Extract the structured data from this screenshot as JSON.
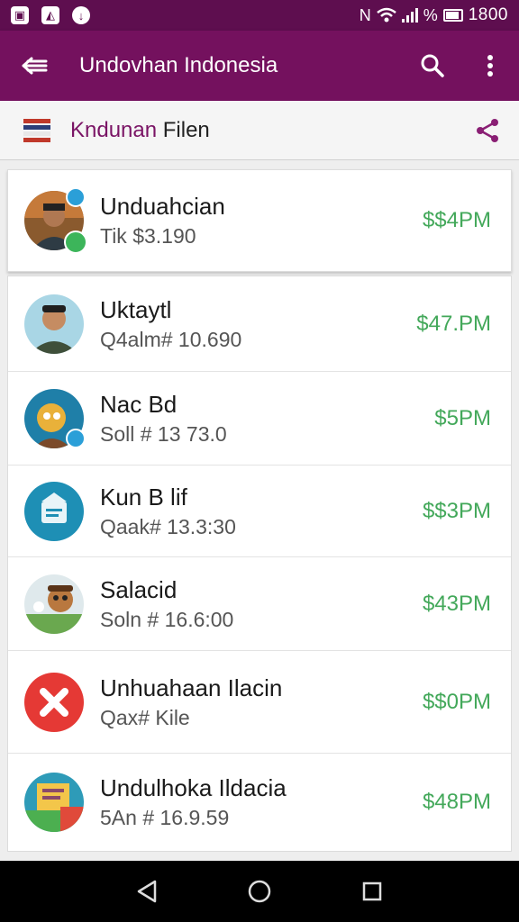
{
  "status": {
    "time": "1800",
    "percent": "%",
    "nfc": "N",
    "notif_icons": [
      "gallery-notification-icon",
      "image-notification-icon",
      "download-notification-icon"
    ]
  },
  "appbar": {
    "title": "Undovhan Indonesia"
  },
  "subbar": {
    "title_a": "Kndunan",
    "title_b": " Filen"
  },
  "featured": {
    "name": "Unduahcian",
    "sub": "Tik $3.190",
    "amount": "$$4PM"
  },
  "items": [
    {
      "name": "Uktaytl",
      "sub": "Q4alm# 10.690",
      "amount": "$47.PM"
    },
    {
      "name": "Nac Bd",
      "sub": "Soll # 13 73.0",
      "amount": "$5PM"
    },
    {
      "name": "Kun B lif",
      "sub": "Qaak# 13.3:30",
      "amount": "$$3PM"
    },
    {
      "name": "Salacid",
      "sub": "Soln # 16.6:00",
      "amount": "$43PM"
    },
    {
      "name": "Unhuahaan Ilacin",
      "sub": "Qax# Kile",
      "amount": "$$0PM"
    },
    {
      "name": "Undulhoka Ildacia",
      "sub": "5An # 16.9.59",
      "amount": "$48PM"
    }
  ],
  "colors": {
    "statusbar": "#5e0e4f",
    "appbar": "#74115e",
    "accent": "#8a1f74",
    "amount": "#43a85a"
  }
}
